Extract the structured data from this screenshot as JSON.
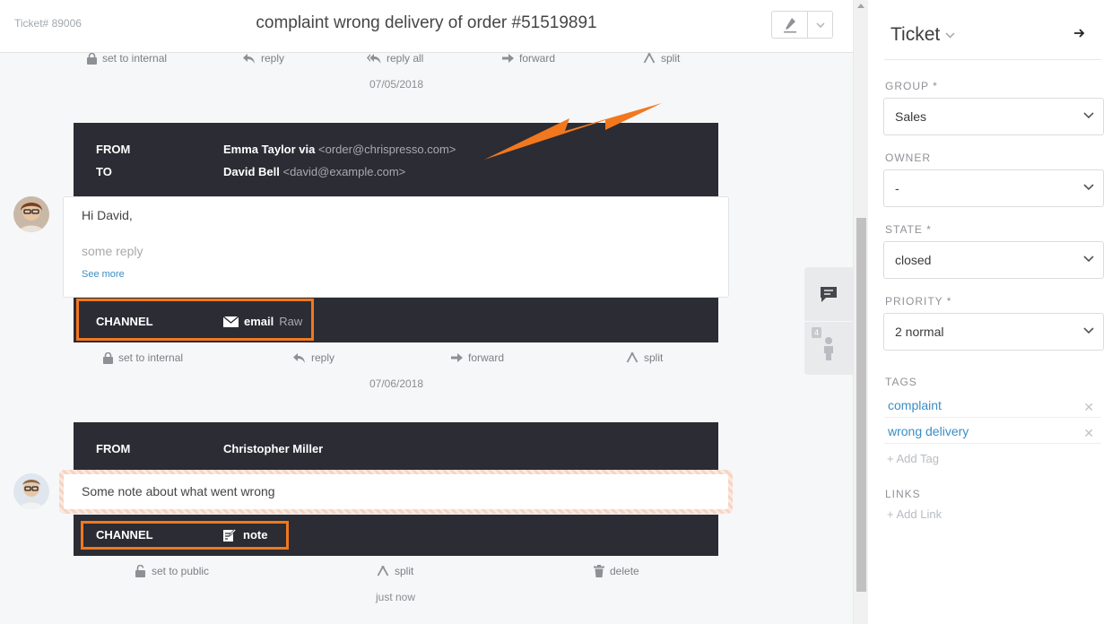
{
  "header": {
    "ticket_number": "Ticket# 89006",
    "title": "complaint wrong delivery of order #51519891",
    "edit_icon": "pencil-icon",
    "menu_icon": "chevron-down-icon"
  },
  "timeline": {
    "actions_top": {
      "set_internal": "set to internal",
      "reply": "reply",
      "reply_all": "reply all",
      "forward": "forward",
      "split": "split"
    },
    "date_1": "07/05/2018",
    "article_email": {
      "from_label": "FROM",
      "from_name": "Emma Taylor via",
      "from_address": "<order@chrispresso.com>",
      "to_label": "TO",
      "to_name": "David Bell",
      "to_address": "<david@example.com>",
      "greeting": "Hi David,",
      "body": "some reply",
      "see_more": "See more",
      "channel_label": "CHANNEL",
      "channel_value": "email",
      "channel_raw": "Raw"
    },
    "actions_mid": {
      "set_internal": "set to internal",
      "reply": "reply",
      "forward": "forward",
      "split": "split"
    },
    "date_2": "07/06/2018",
    "article_note": {
      "from_label": "FROM",
      "from_name": "Christopher Miller",
      "body": "Some note about what went wrong",
      "channel_label": "CHANNEL",
      "channel_value": "note"
    },
    "actions_bottom": {
      "set_public": "set to public",
      "split": "split",
      "delete": "delete"
    },
    "date_3": "just now"
  },
  "side_tabs": {
    "customer_badge": "4"
  },
  "sidebar": {
    "title": "Ticket",
    "group_label": "GROUP *",
    "group_value": "Sales",
    "owner_label": "OWNER",
    "owner_value": "-",
    "state_label": "STATE *",
    "state_value": "closed",
    "priority_label": "PRIORITY *",
    "priority_value": "2 normal",
    "tags_label": "TAGS",
    "tags": [
      "complaint",
      "wrong delivery"
    ],
    "add_tag": "+ Add Tag",
    "links_label": "LINKS",
    "add_link": "+ Add Link"
  },
  "colors": {
    "highlight": "#f1781e",
    "article_header": "#2b2c34",
    "link": "#3a8dc5"
  }
}
